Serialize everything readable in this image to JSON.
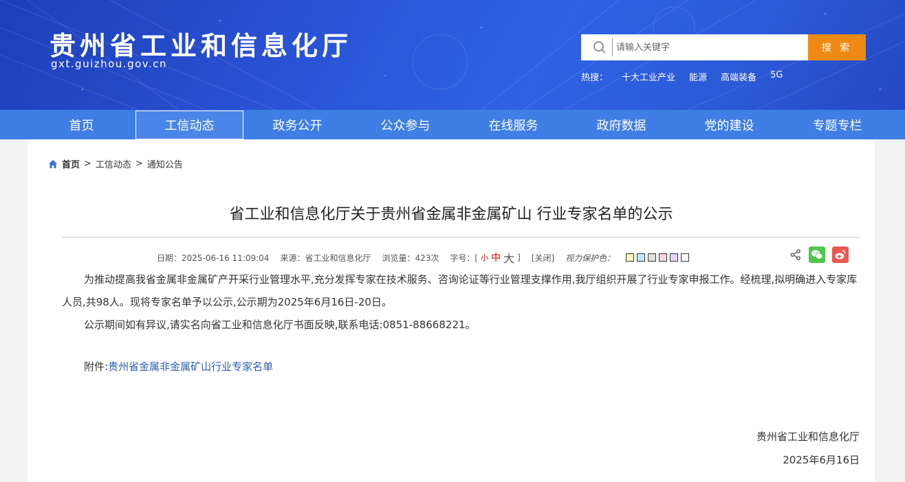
{
  "header": {
    "site_title": "贵州省工业和信息化厅",
    "site_url": "gxt.guizhou.gov.cn",
    "search_placeholder": "请输入关键字",
    "search_button": "搜 索",
    "hot_label": "热搜：",
    "hot_items": [
      "十大工业产业",
      "能源",
      "高端装备",
      "5G"
    ]
  },
  "nav": {
    "items": [
      {
        "label": "首页"
      },
      {
        "label": "工信动态",
        "active": true
      },
      {
        "label": "政务公开"
      },
      {
        "label": "公众参与"
      },
      {
        "label": "在线服务"
      },
      {
        "label": "政府数据"
      },
      {
        "label": "党的建设"
      },
      {
        "label": "专题专栏"
      }
    ]
  },
  "breadcrumb": {
    "home": "首页",
    "sep": ">",
    "level1": "工信动态",
    "level2": "通知公告"
  },
  "article": {
    "title": "省工业和信息化厅关于贵州省金属非金属矿山 行业专家名单的公示",
    "meta": {
      "date": "日期：2025-06-16 11:09:04",
      "source": "来源：省工业和信息化厅",
      "views": "浏览量：423次",
      "font_label": "字号：[",
      "font_small": "小",
      "font_mid": "中",
      "font_big": "大",
      "font_close": "]",
      "close": "[关闭]",
      "eye_label": "视力保护色：",
      "swatch_colors": [
        "#faf5c0",
        "#c8e6f5",
        "#e0e0e0",
        "#f5d5e0",
        "#e5d5f5",
        "#ffffff"
      ]
    },
    "paragraph1": "为推动提高我省金属非金属矿产开采行业管理水平,充分发挥专家在技术服务、咨询论证等行业管理支撑作用,我厅组织开展了行业专家申报工作。经梳理,拟明确进入专家库人员,共98人。现将专家名单予以公示,公示期为2025年6月16日-20日。",
    "paragraph2": "公示期间如有异议,请实名向省工业和信息化厅书面反映,联系电话:0851-88668221。",
    "attach_label": "附件:",
    "attach_link": "贵州省金属非金属矿山行业专家名单",
    "sign_org": "贵州省工业和信息化厅",
    "sign_date": "2025年6月16日"
  }
}
